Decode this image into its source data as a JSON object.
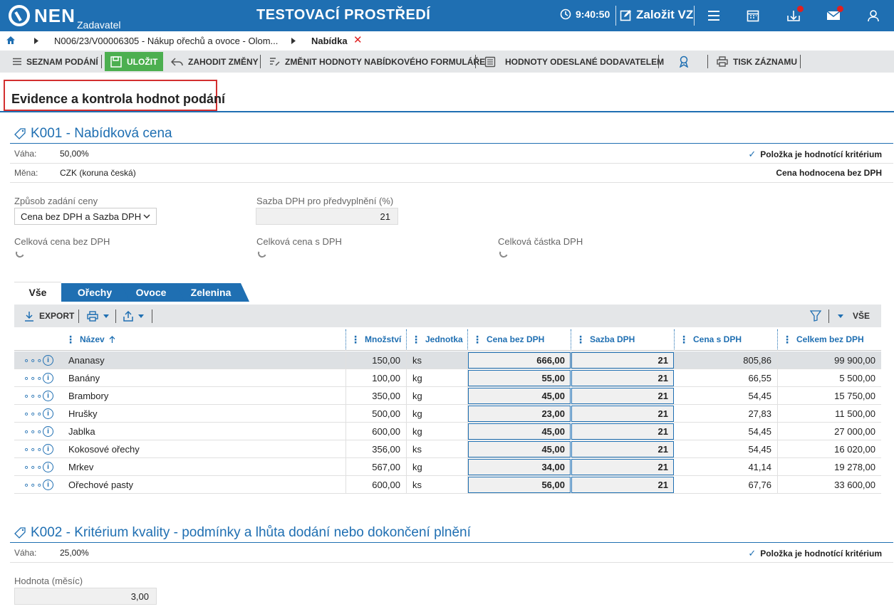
{
  "header": {
    "logo_text": "NEN",
    "logo_sub": "Zadavatel",
    "environment": "TESTOVACÍ PROSTŘEDÍ",
    "clock": "9:40:50",
    "create_label": "Založit VZ"
  },
  "breadcrumb": {
    "path": "N006/23/V00006305 - Nákup ořechů a ovoce - Olom...",
    "current": "Nabídka"
  },
  "toolbar": {
    "seznam": "SEZNAM PODÁNÍ",
    "ulozit": "ULOŽIT",
    "zahodit": "ZAHODIT ZMĚNY",
    "zmenit": "ZMĚNIT HODNOTY NABÍDKOVÉHO FORMULÁŘE",
    "hodnoty": "HODNOTY ODESLANÉ DODAVATELEM",
    "tisk": "TISK ZÁZNAMU"
  },
  "page_title": "Evidence a kontrola hodnot podání",
  "k001": {
    "title": "K001 - Nabídková cena",
    "vaha_label": "Váha:",
    "vaha": "50,00%",
    "mena_label": "Měna:",
    "mena": "CZK (koruna česká)",
    "criterion": "Položka je hodnotící kritérium",
    "cena_hodnocena": "Cena hodnocena bez DPH",
    "zpusob_label": "Způsob zadání ceny",
    "zpusob_value": "Cena bez DPH a Sazba DPH",
    "sazba_label": "Sazba DPH pro předvyplnění (%)",
    "sazba_value": "21",
    "celk_bez_label": "Celková cena bez DPH",
    "celk_s_label": "Celková cena s DPH",
    "celk_dph_label": "Celková částka DPH"
  },
  "tabs": [
    "Vše",
    "Ořechy",
    "Ovoce",
    "Zelenina"
  ],
  "gridbar": {
    "export": "EXPORT",
    "filter_all": "VŠE"
  },
  "grid": {
    "headers": [
      "Název",
      "Množství",
      "Jednotka",
      "Cena bez DPH",
      "Sazba DPH",
      "Cena s DPH",
      "Celkem bez DPH"
    ],
    "rows": [
      {
        "name": "Ananasy",
        "qty": "150,00",
        "unit": "ks",
        "price": "666,00",
        "vat": "21",
        "price_vat": "805,86",
        "total": "99 900,00"
      },
      {
        "name": "Banány",
        "qty": "100,00",
        "unit": "kg",
        "price": "55,00",
        "vat": "21",
        "price_vat": "66,55",
        "total": "5 500,00"
      },
      {
        "name": "Brambory",
        "qty": "350,00",
        "unit": "kg",
        "price": "45,00",
        "vat": "21",
        "price_vat": "54,45",
        "total": "15 750,00"
      },
      {
        "name": "Hrušky",
        "qty": "500,00",
        "unit": "kg",
        "price": "23,00",
        "vat": "21",
        "price_vat": "27,83",
        "total": "11 500,00"
      },
      {
        "name": "Jablka",
        "qty": "600,00",
        "unit": "kg",
        "price": "45,00",
        "vat": "21",
        "price_vat": "54,45",
        "total": "27 000,00"
      },
      {
        "name": "Kokosové ořechy",
        "qty": "356,00",
        "unit": "ks",
        "price": "45,00",
        "vat": "21",
        "price_vat": "54,45",
        "total": "16 020,00"
      },
      {
        "name": "Mrkev",
        "qty": "567,00",
        "unit": "kg",
        "price": "34,00",
        "vat": "21",
        "price_vat": "41,14",
        "total": "19 278,00"
      },
      {
        "name": "Ořechové pasty",
        "qty": "600,00",
        "unit": "ks",
        "price": "56,00",
        "vat": "21",
        "price_vat": "67,76",
        "total": "33 600,00"
      }
    ]
  },
  "k002": {
    "title": "K002 - Kritérium kvality - podmínky a lhůta dodání nebo dokončení plnění",
    "vaha_label": "Váha:",
    "vaha": "25,00%",
    "criterion": "Položka je hodnotící kritérium",
    "hodnota_label": "Hodnota (měsíc)",
    "hodnota_value": "3,00"
  },
  "colors": {
    "primary": "#1f6fb2",
    "save": "#4caf50",
    "alert": "#d32f2f"
  }
}
